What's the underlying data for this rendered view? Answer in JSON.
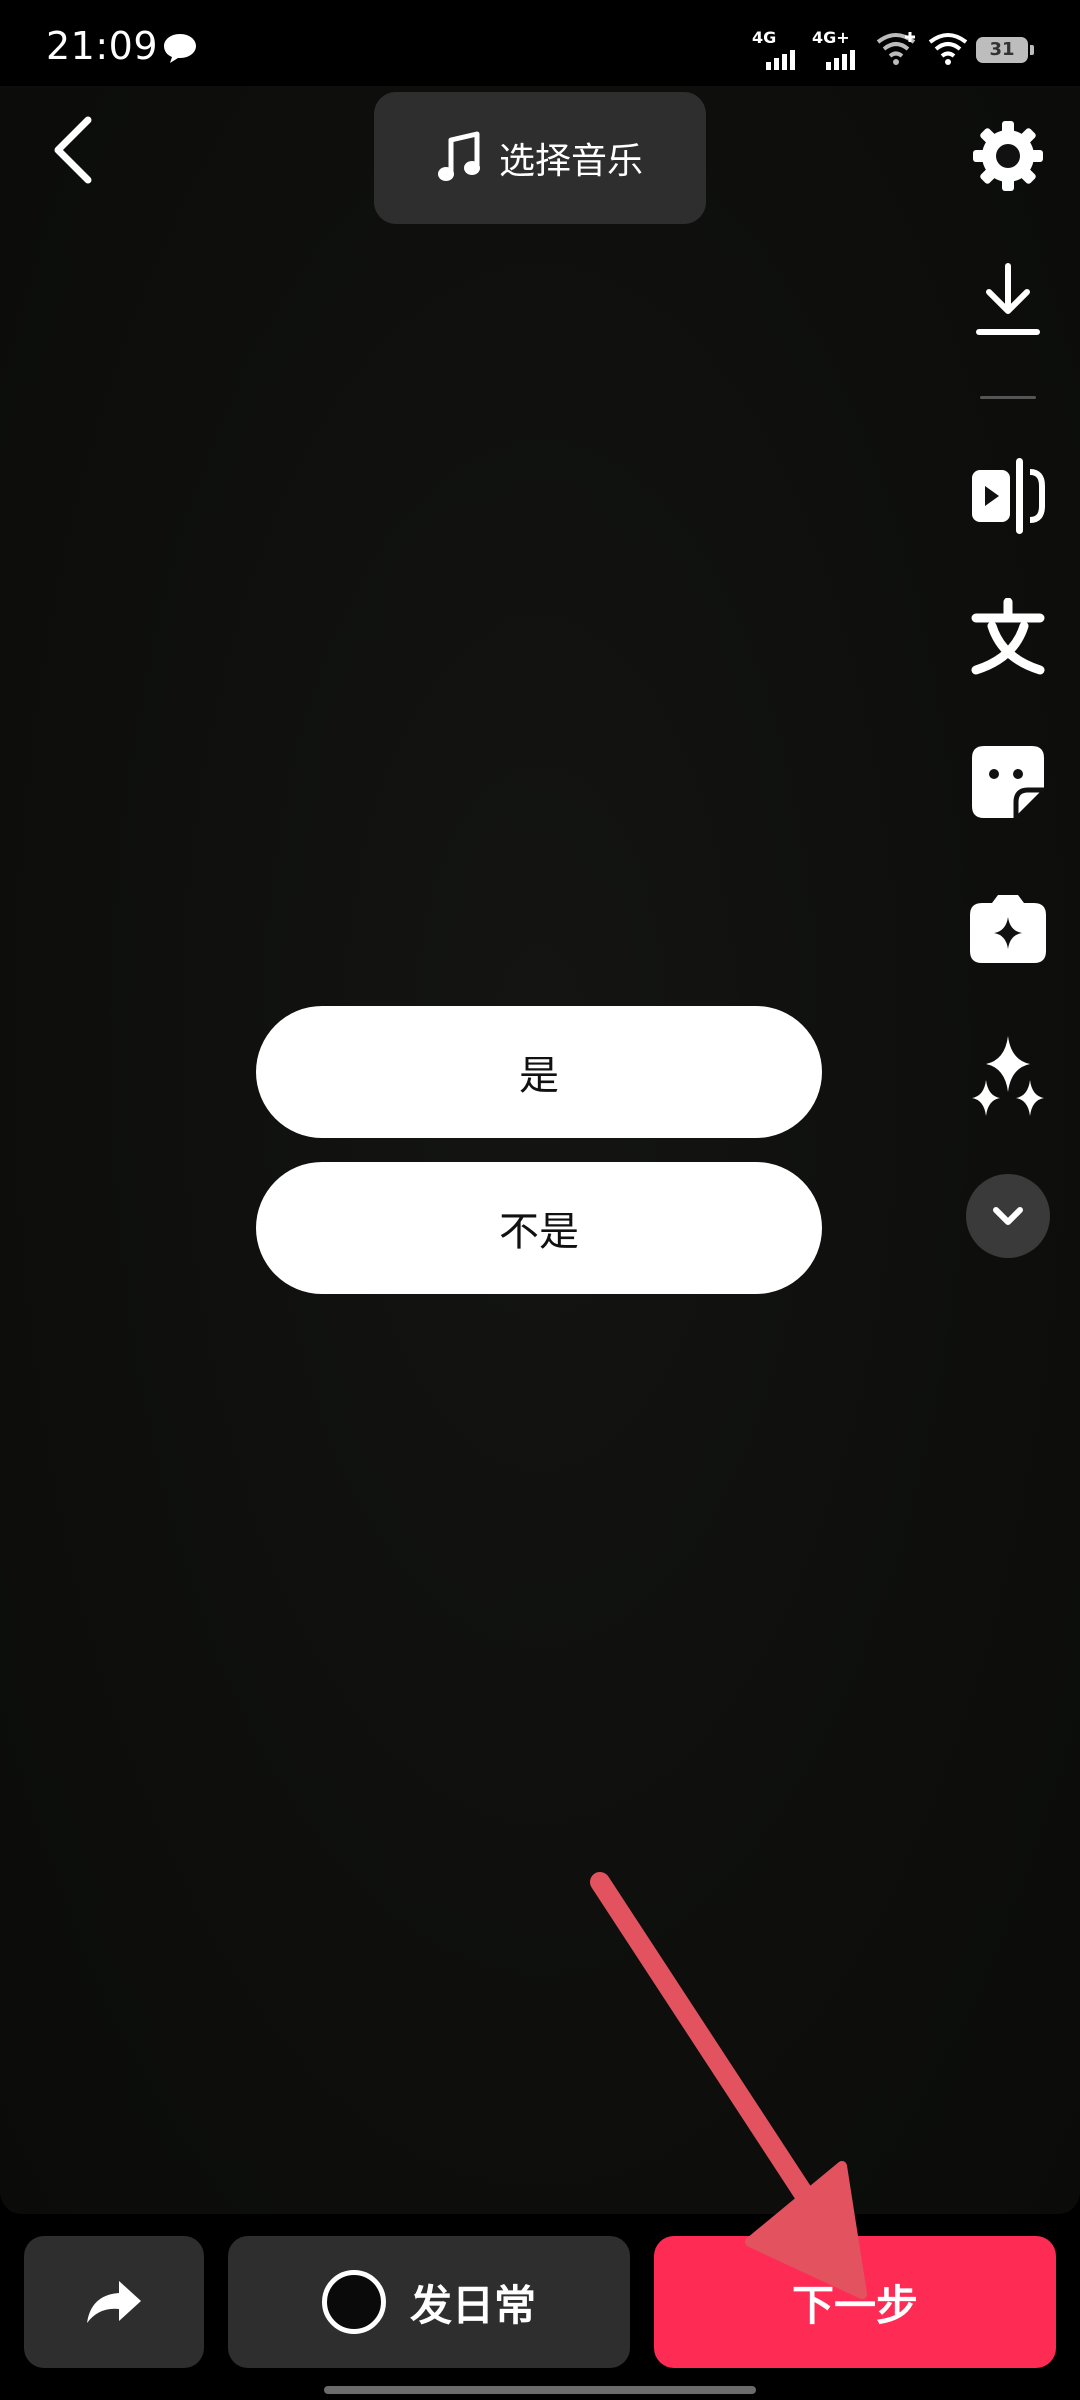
{
  "status_bar": {
    "time": "21:09",
    "signal1_label": "4G",
    "signal2_label": "4G+",
    "battery": "31"
  },
  "top": {
    "music_label": "选择音乐"
  },
  "sidebar": {
    "icons": [
      "settings-icon",
      "download-icon",
      "clip-icon",
      "text-icon",
      "sticker-icon",
      "effects-icon",
      "enhance-icon",
      "chevron-down-icon"
    ]
  },
  "choices": {
    "yes": "是",
    "no": "不是"
  },
  "bottom": {
    "daily_label": "发日常",
    "next_label": "下一步"
  },
  "colors": {
    "accent": "#fe2c55",
    "annotation_arrow": "#e2535f"
  }
}
